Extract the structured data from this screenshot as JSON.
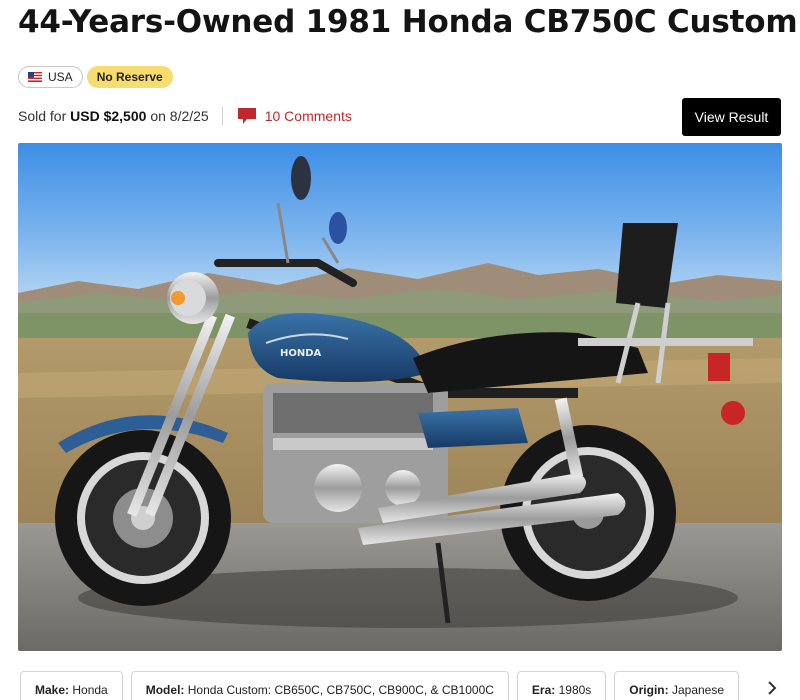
{
  "listing": {
    "title": "44-Years-Owned 1981 Honda CB750C Custom"
  },
  "badges": {
    "country": "USA",
    "reserve": "No Reserve"
  },
  "sale": {
    "prefix": "Sold for",
    "price": "USD $2,500",
    "date_prefix": "on",
    "date": "8/2/25",
    "comments": "10 Comments"
  },
  "actions": {
    "view_result": "View Result"
  },
  "photo": {
    "subject": "Blue 1981 Honda CB750C Custom motorcycle parked on road with desert mountains behind",
    "tank_text": "HONDA"
  },
  "specs": [
    {
      "key": "Make:",
      "value": "Honda"
    },
    {
      "key": "Model:",
      "value": "Honda Custom: CB650C, CB750C, CB900C, & CB1000C"
    },
    {
      "key": "Era:",
      "value": "1980s"
    },
    {
      "key": "Origin:",
      "value": "Japanese"
    }
  ],
  "colors": {
    "accent_red": "#c0282b",
    "badge_yellow": "#f7dc6f",
    "button_black": "#000000"
  },
  "icons": {
    "flag": "us-flag-icon",
    "comments": "comment-bubble-icon",
    "next": "chevron-right-icon"
  }
}
